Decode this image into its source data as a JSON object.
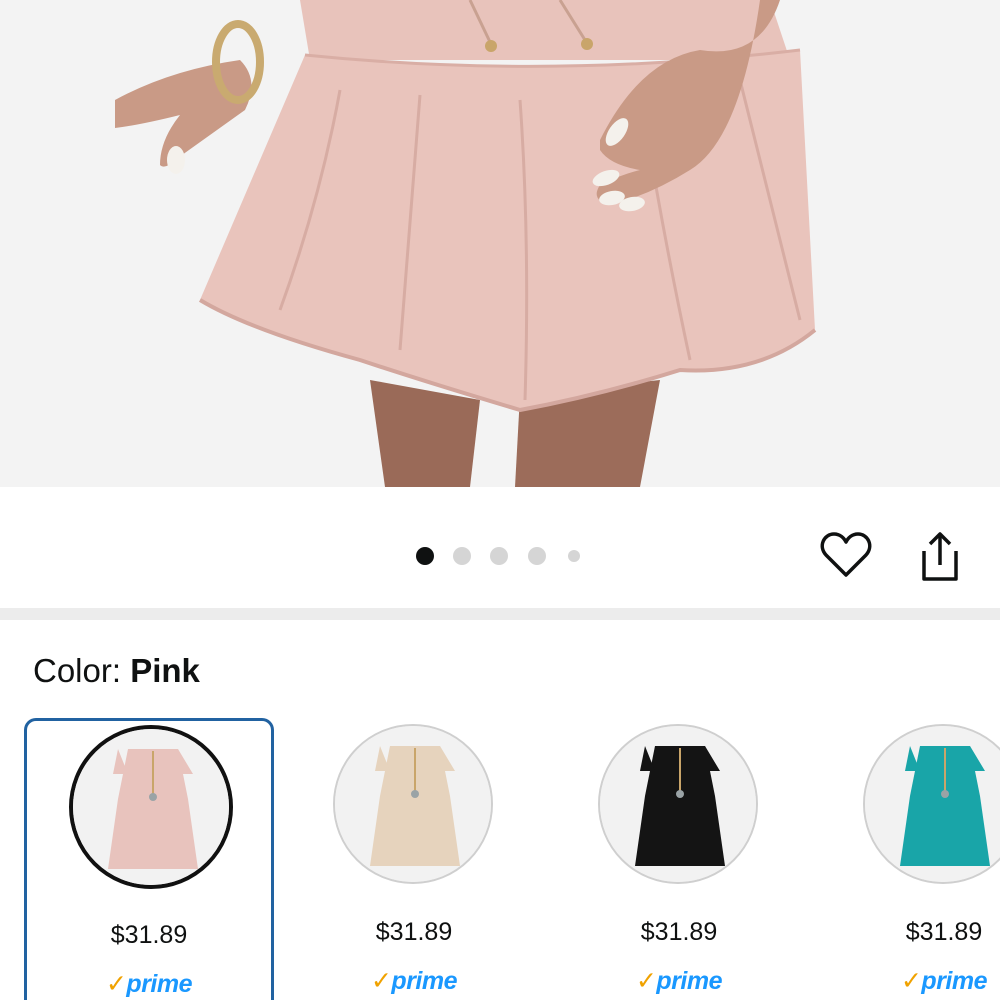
{
  "gallery": {
    "image_alt": "Woman wearing pink ruffle tiered mini dress",
    "dot_count": 5,
    "active_dot": 0
  },
  "actions": {
    "wishlist_icon": "heart-icon",
    "share_icon": "share-icon"
  },
  "color": {
    "label": "Color: ",
    "selected": "Pink"
  },
  "swatches": [
    {
      "name": "Pink",
      "price": "$31.89",
      "prime": "prime",
      "dress_color": "#e8c3bd",
      "selected": true
    },
    {
      "name": "Beige",
      "price": "$31.89",
      "prime": "prime",
      "dress_color": "#e6d3bd",
      "selected": false
    },
    {
      "name": "Black",
      "price": "$31.89",
      "prime": "prime",
      "dress_color": "#141414",
      "selected": false
    },
    {
      "name": "Teal",
      "price": "$31.89",
      "prime": "prime",
      "dress_color": "#19a5a8",
      "selected": false
    }
  ],
  "colors": {
    "accent_blue": "#2162a1",
    "prime_blue": "#1a98ff",
    "prime_check": "#f0a200"
  }
}
